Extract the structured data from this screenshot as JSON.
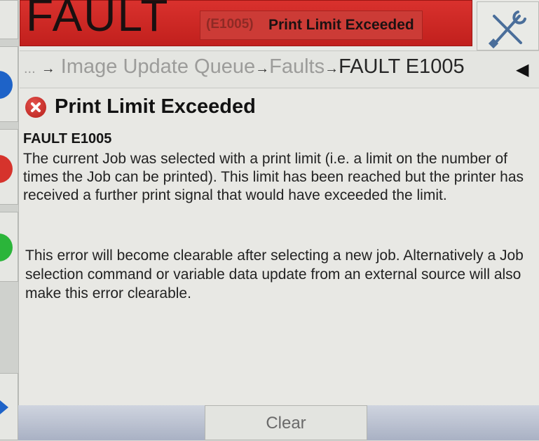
{
  "header": {
    "status_title": "FAULT",
    "fault_code": "(E1005)",
    "fault_message": "Print Limit Exceeded"
  },
  "breadcrumb": {
    "ellipsis": "...",
    "items": [
      "Image Update Queue",
      "Faults"
    ],
    "current": "FAULT E1005",
    "separator": "→"
  },
  "content": {
    "heading": "Print Limit Exceeded",
    "code": "FAULT E1005",
    "paragraph1": "The current Job was selected with a print limit (i.e. a limit on the number of times the Job can be printed). This limit has been reached but the printer has received a further print signal that would have exceeded the limit.",
    "paragraph2": "This error will become clearable after selecting a new job. Alternatively a Job selection command or variable data update from an external source will also make this error clearable."
  },
  "footer": {
    "clear_label": "Clear"
  },
  "colors": {
    "fault_red": "#c1201d",
    "rail_blue": "#1e63c8",
    "rail_red": "#d6332c",
    "rail_green": "#2bb53a"
  }
}
